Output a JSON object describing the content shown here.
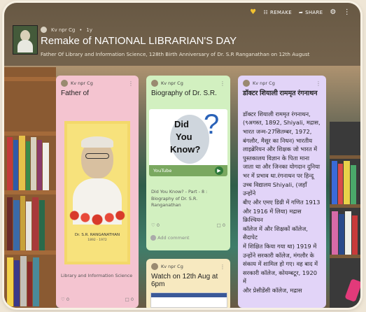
{
  "topbar": {
    "remake": "REMAKE",
    "share": "SHARE"
  },
  "header": {
    "author": "Kv npr Cg",
    "age": "1y",
    "title": "Remake of NATIONAL LIBRARIAN'S DAY",
    "subtitle": "Father Of Library and Information Science, 128th Birth Anniversary of Dr. S.R Ranganathan on 12th August"
  },
  "cards": {
    "c1": {
      "author": "Kv npr Cg",
      "title": "Father of",
      "portrait_caption": "Dr. S.R. RANGANATHAN",
      "portrait_years": "1892 - 1972",
      "text": "Library and Information Science",
      "likes": "0",
      "comments": "0"
    },
    "c2": {
      "author": "Kv npr Cg",
      "title": "Biography of Dr. S.R.",
      "thumb_word1": "Did",
      "thumb_word2": "You",
      "thumb_word3": "Know?",
      "source": "YouTube",
      "text": "Did You Know? - Part - 8 : Biography of Dr. S.R. Ranganathan",
      "likes": "0",
      "comments": "0",
      "add_comment": "Add comment"
    },
    "c3": {
      "author": "Kv npr Cg",
      "title": "डॉक्टर शियाली राममृत रंगनाथन",
      "lines": [
        "डॉक्टर शियाली राममृत रंगनाथन,",
        "(९अगस्त, 1892, Shiyali, मद्रास,",
        "भारत जन्म-27सितम्बर, 1972,",
        "बंगलौर, मैसूर का निधन) भारतीय",
        "लाइब्रेरियन और शिक्षक जो भारत में",
        "पुस्तकालय विज्ञान के पिता माना",
        "जाता था और जिनका योगदान दुनिया",
        "भर में प्रभाव था.रंगनाथन पर हिन्दू",
        "उच्च विद्यालय Shiyali, (जहाँ उन्होंने",
        "बीए और एमए डिग्री में गणित 1913",
        "और 1916 में लिया) मद्रास क्रिश्चियन",
        "कॉलेज में और शिक्षकों कॉलेज, सैदापेट",
        "में शिक्षित किया गया था) 1919 में",
        "उन्होंने सरकारी कॉलेज, मंगलौर के",
        "संकाय में शामिल हो गए। वह बाद में",
        "सरकारी कॉलेज, कोयम्बटूर, 1920 में",
        "और प्रेसीडेंसी कॉलेज, मद्रास"
      ]
    },
    "c4": {
      "author": "Kv npr Cg",
      "title": "Watch on 12th Aug at 6pm"
    }
  }
}
